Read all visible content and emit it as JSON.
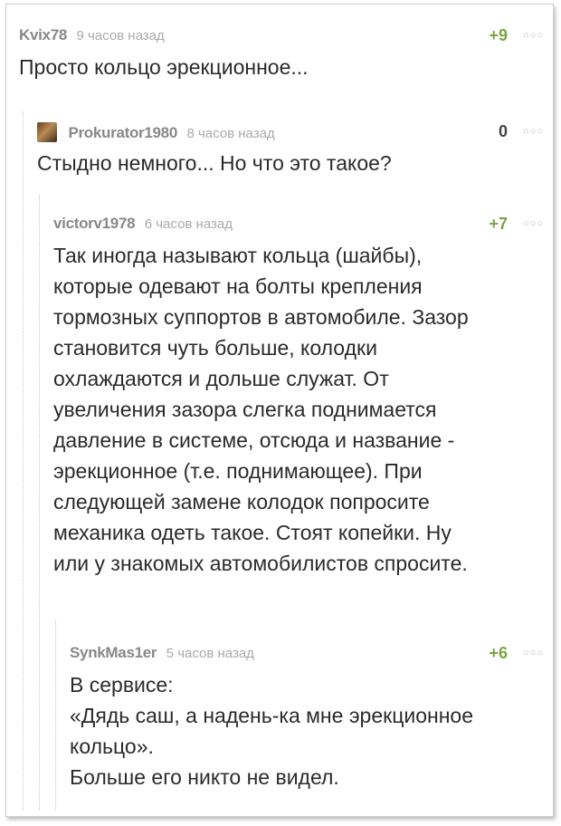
{
  "comments": [
    {
      "author": "Kvix78",
      "time": "9 часов назад",
      "rating": "+9",
      "lines": [
        "Просто кольцо эрекционное..."
      ]
    },
    {
      "author": "Prokurator1980",
      "time": "8 часов назад",
      "rating": "0",
      "avatar_icon": "user-avatar-icon",
      "lines": [
        "Стыдно немного... Но что это такое?"
      ]
    },
    {
      "author": "victorv1978",
      "time": "6 часов назад",
      "rating": "+7",
      "lines": [
        "Так иногда называют кольца (шайбы),",
        "которые одевают на болты крепления",
        "тормозных суппортов в автомобиле. Зазор",
        "становится чуть больше, колодки",
        "охлаждаются и дольше служат. От",
        "увеличения зазора слегка поднимается",
        "давление в системе, отсюда и название -",
        "эрекционное (т.е. поднимающее). При",
        "следующей замене колодок попросите",
        "механика одеть такое. Стоят копейки. Ну",
        "или у знакомых автомобилистов спросите."
      ]
    },
    {
      "author": "SynkMas1er",
      "time": "5 часов назад",
      "rating": "+6",
      "lines": [
        "В сервисе:",
        "«Дядь саш, а надень-ка мне эрекционное",
        "кольцо».",
        "Больше его никто не видел."
      ]
    }
  ],
  "menu_glyph": "○○○",
  "colors": {
    "positive": "#7aa542",
    "author": "#888888",
    "text": "#2b2b2b"
  }
}
